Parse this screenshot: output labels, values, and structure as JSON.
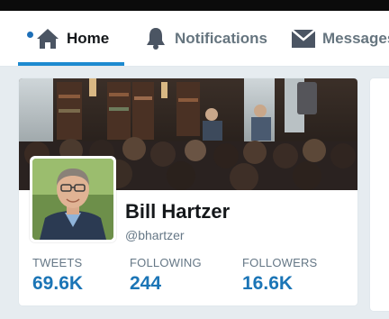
{
  "nav": {
    "home": {
      "label": "Home",
      "icon": "home-icon",
      "active": true
    },
    "notifications": {
      "label": "Notifications",
      "icon": "bell-icon"
    },
    "messages": {
      "label": "Messages",
      "icon": "envelope-icon"
    }
  },
  "profile": {
    "name": "Bill Hartzer",
    "handle": "@bhartzer"
  },
  "stats": [
    {
      "label": "TWEETS",
      "value": "69.6K"
    },
    {
      "label": "FOLLOWING",
      "value": "244"
    },
    {
      "label": "FOLLOWERS",
      "value": "16.6K"
    }
  ],
  "colors": {
    "accent": "#1d8ad0",
    "stat_value": "#1b75b6",
    "muted_text": "#657786",
    "background": "#e6ecf0"
  }
}
